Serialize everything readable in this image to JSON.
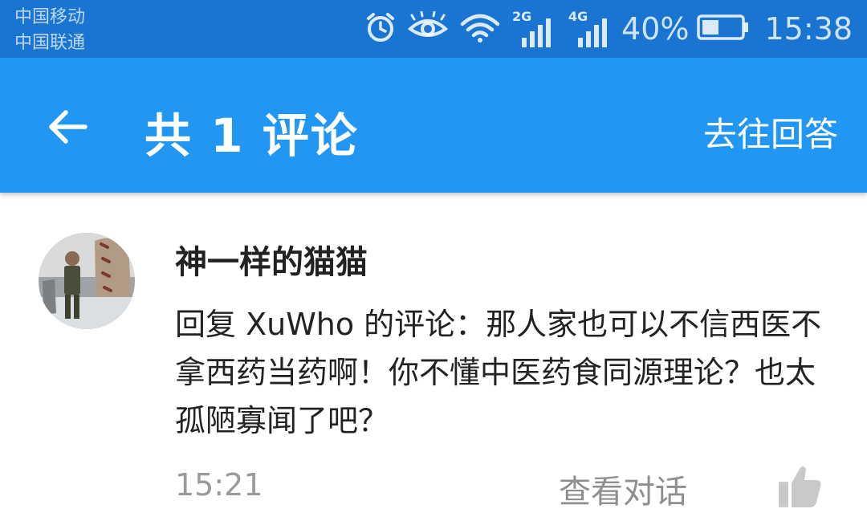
{
  "status_bar": {
    "carrier_1": "中国移动",
    "carrier_2": "中国联通",
    "signal_1_label": "2G",
    "signal_2_label": "4G",
    "battery_percent": "40%",
    "time": "15:38",
    "icons": [
      "alarm-icon",
      "eye-icon",
      "wifi-icon",
      "signal-2g-icon",
      "signal-4g-icon",
      "battery-icon"
    ]
  },
  "toolbar": {
    "title": "共 1 评论",
    "action_label": "去往回答",
    "background_color": "#2196f3"
  },
  "comment": {
    "username": "神一样的猫猫",
    "text": "回复 XuWho 的评论：那人家也可以不信西医不拿西药当药啊！你不懂中医药食同源理论？也太孤陋寡闻了吧？",
    "time": "15:21",
    "view_conversation_label": "查看对话",
    "avatar_icon": "avatar-photo",
    "like_icon": "thumbs-up-icon"
  }
}
